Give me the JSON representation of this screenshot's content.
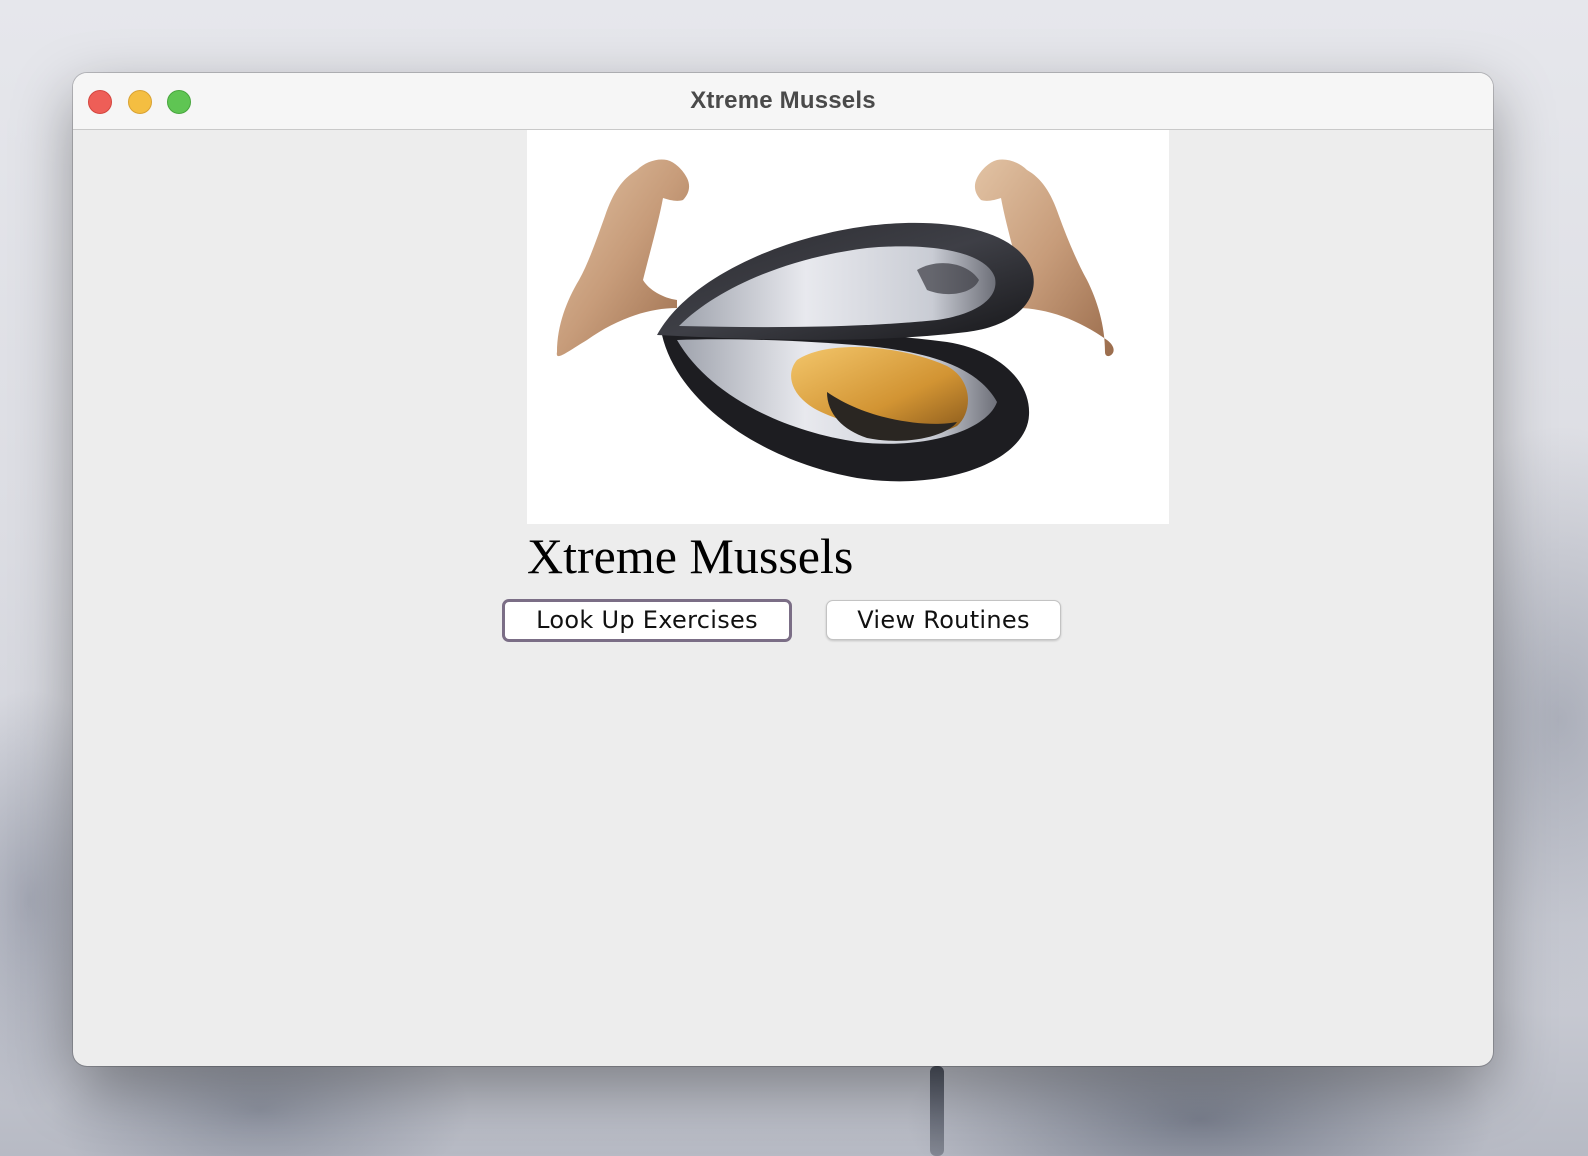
{
  "window": {
    "title": "Xtreme Mussels"
  },
  "main": {
    "image": {
      "icon": "flexing-mussel-logo"
    },
    "heading": "Xtreme Mussels",
    "buttons": {
      "lookup_exercises": "Look Up Exercises",
      "view_routines": "View Routines"
    }
  },
  "colors": {
    "close": "#ee5e57",
    "minimize": "#f4be41",
    "zoom": "#5fc553",
    "focus_ring": "#7b6e86",
    "window_background": "#ededed"
  }
}
